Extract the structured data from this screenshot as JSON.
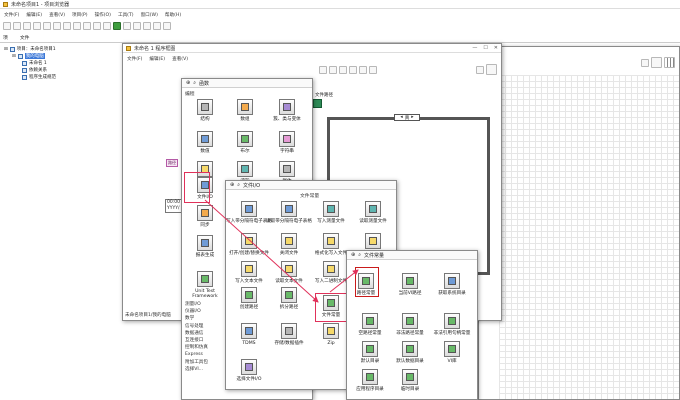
{
  "main_window": {
    "title": "未命名项目1 - 项目浏览器",
    "menu": [
      "文件(F)",
      "编辑(E)",
      "查看(V)",
      "项目(P)",
      "操作(O)",
      "工具(T)",
      "窗口(W)",
      "帮助(H)"
    ],
    "tab_items": "项",
    "tab_files": "文件",
    "tree": [
      "项目：未命名项目1",
      "我的电脑",
      "未命名 1",
      "依赖关系",
      "程序生成规范"
    ]
  },
  "block_diagram": {
    "title": "未命名 1 程序框图",
    "menu": [
      "文件(F)",
      "编辑(E)",
      "查看(V)"
    ],
    "status_left": "未命名项目1/我的电脑",
    "path_label": "路径",
    "tag_label": "文件路径",
    "time_label": "00:00",
    "date_label": "YYYY/",
    "case_selector": "真"
  },
  "functions_palette": {
    "title": "函数",
    "category": "编程",
    "items": [
      "结构",
      "数组",
      "簇、类与变体",
      "数值",
      "布尔",
      "字符串",
      "比较",
      "波形",
      "群体",
      "文件I/O",
      "",
      "",
      "同步",
      "",
      "",
      "报表生成",
      "",
      "",
      "Unit Test Framework",
      "",
      ""
    ],
    "side_list": [
      "测量I/O",
      "仪器I/O",
      "数学",
      "信号处理",
      "数据通信",
      "互连接口",
      "控制和仿真",
      "Express",
      "附加工具包",
      "选择VI..."
    ]
  },
  "file_io_palette": {
    "title": "文件I/O",
    "subheader": "文件常量",
    "items": [
      "写入带分隔符电子表格",
      "读取带分隔符电子表格",
      "写入测量文件",
      "读取测量文件",
      "打开/创建/替换文件",
      "关闭文件",
      "格式化写入文件",
      "扫描文件",
      "写入文本文件",
      "读取文本文件",
      "写入二进制文件",
      "读取二进制文件",
      "创建路径",
      "拆分路径",
      "文件常量",
      "",
      "TDMS",
      "存储/数据插件",
      "Zip",
      "",
      "选择文件I/O"
    ]
  },
  "file_constants_palette": {
    "title": "文件常量",
    "items": [
      "路径常量",
      "当前VI路径",
      "获取系统目录",
      "空路径常量",
      "非法路径常量",
      "非法引用句柄常量",
      "默认目录",
      "默认数据目录",
      "VI库",
      "应用程序目录",
      "临时目录"
    ]
  },
  "colors": {
    "highlight": "#e0315a",
    "arrow": "#e0315a"
  }
}
